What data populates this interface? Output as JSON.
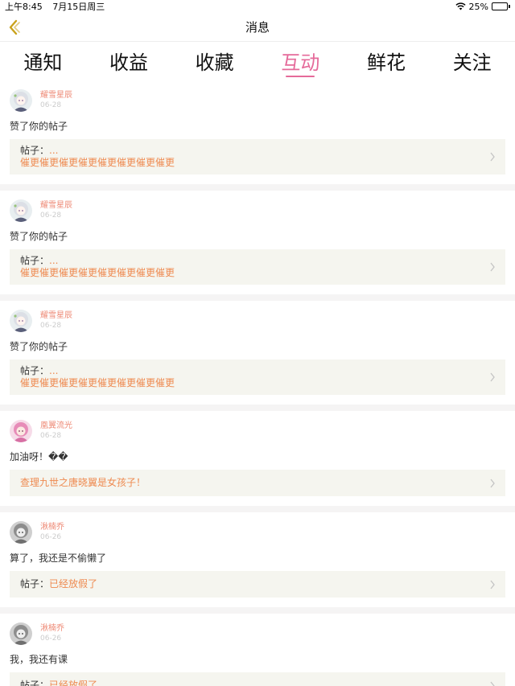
{
  "status": {
    "time": "上午8:45",
    "date": "7月15日周三",
    "battery": "25%",
    "battery_level": 0.25
  },
  "nav": {
    "title": "消息",
    "back_icon": "chevron-left-icon"
  },
  "tabs": [
    {
      "label": "通知",
      "active": false
    },
    {
      "label": "收益",
      "active": false
    },
    {
      "label": "收藏",
      "active": false
    },
    {
      "label": "互动",
      "active": true
    },
    {
      "label": "鲜花",
      "active": false
    },
    {
      "label": "关注",
      "active": false
    }
  ],
  "colors": {
    "accent": "#e56a9a",
    "username": "#ee8a76",
    "quote_text": "#ee8a50",
    "quote_bg": "#f5f5ef"
  },
  "feed": [
    {
      "user": "耀雪星辰",
      "date": "06-28",
      "comment": "赞了你的帖子",
      "quote_label": "帖子：",
      "quote_title": "...",
      "quote_text": "催更催更催更催更催更催更催更催更",
      "avatar": "avatar-girl-white-hair"
    },
    {
      "user": "耀雪星辰",
      "date": "06-28",
      "comment": "赞了你的帖子",
      "quote_label": "帖子：",
      "quote_title": "...",
      "quote_text": "催更催更催更催更催更催更催更催更",
      "avatar": "avatar-girl-white-hair"
    },
    {
      "user": "耀雪星辰",
      "date": "06-28",
      "comment": "赞了你的帖子",
      "quote_label": "帖子：",
      "quote_title": "...",
      "quote_text": "催更催更催更催更催更催更催更催更",
      "avatar": "avatar-girl-white-hair"
    },
    {
      "user": "凰翼流光",
      "date": "06-28",
      "comment": "加油呀！��",
      "quote_label": "",
      "quote_title": "",
      "quote_text": "查理九世之唐晓翼是女孩子！",
      "avatar": "avatar-girl-pink-hair"
    },
    {
      "user": "湫楠乔",
      "date": "06-26",
      "comment": "算了，我还是不偷懒了",
      "quote_label": "帖子：",
      "quote_title": "",
      "quote_text": "已经放假了",
      "avatar": "avatar-girl-grey"
    },
    {
      "user": "湫楠乔",
      "date": "06-26",
      "comment": "我，我还有课",
      "quote_label": "帖子：",
      "quote_title": "",
      "quote_text": "已经放假了",
      "avatar": "avatar-girl-grey"
    }
  ]
}
